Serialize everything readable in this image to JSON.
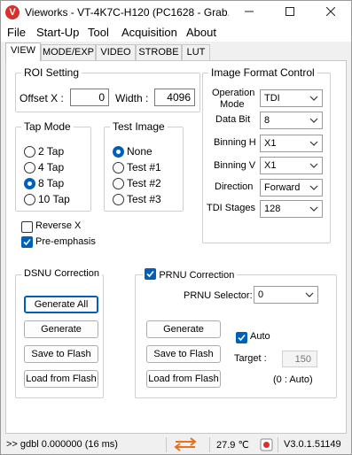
{
  "window": {
    "title": "Vieworks - VT-4K7C-H120 (PC1628 - Grab...",
    "app_icon_glyph": "V",
    "app_icon_color": "#d9302c"
  },
  "menu": {
    "items": [
      {
        "label": "File"
      },
      {
        "label": "Start-Up"
      },
      {
        "label": "Tool"
      },
      {
        "label": "Acquisition"
      },
      {
        "label": "About"
      }
    ]
  },
  "tabs": [
    {
      "label": "VIEW",
      "active": true
    },
    {
      "label": "MODE/EXP",
      "active": false
    },
    {
      "label": "VIDEO",
      "active": false
    },
    {
      "label": "STROBE",
      "active": false
    },
    {
      "label": "LUT",
      "active": false
    }
  ],
  "roi": {
    "title": "ROI Setting",
    "offset_x_label": "Offset X :",
    "offset_x_value": "0",
    "width_label": "Width :",
    "width_value": "4096"
  },
  "tap_mode": {
    "title": "Tap Mode",
    "options": [
      {
        "label": "2 Tap",
        "checked": false
      },
      {
        "label": "4 Tap",
        "checked": false
      },
      {
        "label": "8 Tap",
        "checked": true
      },
      {
        "label": "10 Tap",
        "checked": false
      }
    ]
  },
  "test_image": {
    "title": "Test Image",
    "options": [
      {
        "label": "None",
        "checked": true
      },
      {
        "label": "Test #1",
        "checked": false
      },
      {
        "label": "Test #2",
        "checked": false
      },
      {
        "label": "Test #3",
        "checked": false
      }
    ]
  },
  "image_format": {
    "title": "Image Format Control",
    "operation_mode_label_1": "Operation",
    "operation_mode_label_2": "Mode",
    "operation_mode_value": "TDI",
    "data_bit_label": "Data Bit",
    "data_bit_value": "8",
    "binning_h_label": "Binning H",
    "binning_h_value": "X1",
    "binning_v_label": "Binning V",
    "binning_v_value": "X1",
    "direction_label": "Direction",
    "direction_value": "Forward",
    "tdi_stages_label": "TDI Stages",
    "tdi_stages_value": "128"
  },
  "options": {
    "reverse_x_label": "Reverse X",
    "reverse_x_checked": false,
    "pre_emphasis_label": "Pre-emphasis",
    "pre_emphasis_checked": true
  },
  "dsnu": {
    "title": "DSNU Correction",
    "generate_all_label": "Generate All",
    "generate_label": "Generate",
    "save_label": "Save to Flash",
    "load_label": "Load from Flash"
  },
  "prnu": {
    "title": "PRNU Correction",
    "enabled": true,
    "selector_label": "PRNU Selector:",
    "selector_value": "0",
    "generate_label": "Generate",
    "save_label": "Save to Flash",
    "load_label": "Load from Flash",
    "auto_label": "Auto",
    "auto_checked": true,
    "target_label": "Target :",
    "target_value": "150",
    "auto_note": "(0 : Auto)"
  },
  "status": {
    "message": ">> gdbl  0.000000  (16 ms)",
    "temperature": "27.9 ℃",
    "version": "V3.0.1.51149",
    "arrows_color": "#e8711c",
    "accent": "#005fb8"
  }
}
